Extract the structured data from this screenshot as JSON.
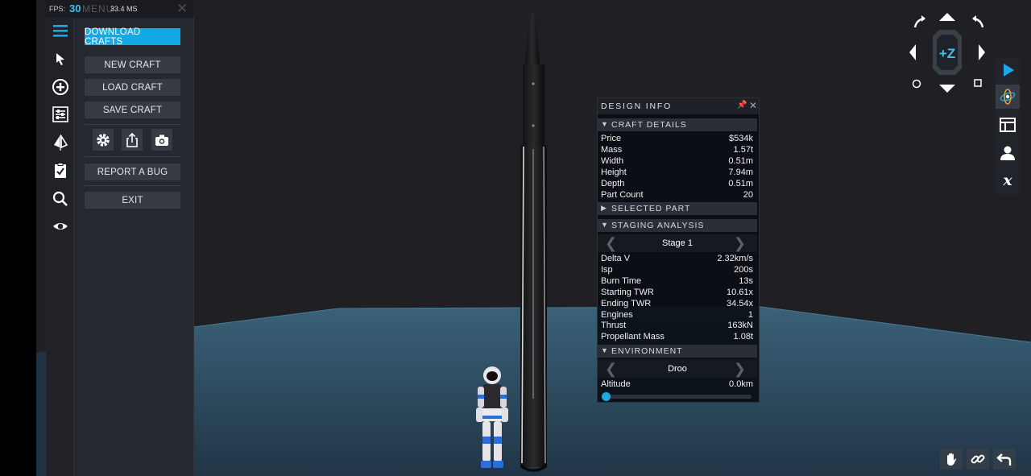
{
  "fps_bar": {
    "fps_label": "FPS:",
    "fps_value": "30",
    "ghost_text": "MENU",
    "ms_value": "33.4",
    "ms_unit": "MS",
    "close_glyph": "✕"
  },
  "icon_bar": [
    "hamburger-menu-icon",
    "select-cursor-icon",
    "add-part-icon",
    "properties-icon",
    "symmetry-icon",
    "checklist-icon",
    "search-icon",
    "view-icon"
  ],
  "menu": {
    "download_crafts": "DOWNLOAD CRAFTS",
    "new_craft": "NEW CRAFT",
    "load_craft": "LOAD CRAFT",
    "save_craft": "SAVE CRAFT",
    "tool_icons": [
      "gear-icon",
      "share-icon",
      "camera-icon"
    ],
    "report_bug": "REPORT A BUG",
    "exit": "EXIT"
  },
  "design_info": {
    "title": "DESIGN INFO",
    "pin_glyph": "📌",
    "close_glyph": "✕",
    "craft_details": {
      "header": "CRAFT DETAILS",
      "rows": [
        {
          "k": "Price",
          "v": "$534k"
        },
        {
          "k": "Mass",
          "v": "1.57t"
        },
        {
          "k": "Width",
          "v": "0.51m"
        },
        {
          "k": "Height",
          "v": "7.94m"
        },
        {
          "k": "Depth",
          "v": "0.51m"
        },
        {
          "k": "Part Count",
          "v": "20"
        }
      ]
    },
    "selected_part": {
      "header": "SELECTED PART"
    },
    "staging_analysis": {
      "header": "STAGING ANALYSIS",
      "stage": "Stage 1",
      "rows": [
        {
          "k": "Delta V",
          "v": "2.32km/s"
        },
        {
          "k": "Isp",
          "v": "200s"
        },
        {
          "k": "Burn Time",
          "v": "13s"
        },
        {
          "k": "Starting TWR",
          "v": "10.61x"
        },
        {
          "k": "Ending TWR",
          "v": "34.54x"
        },
        {
          "k": "Engines",
          "v": "1"
        },
        {
          "k": "Thrust",
          "v": "163kN"
        },
        {
          "k": "Propellant Mass",
          "v": "1.08t"
        }
      ]
    },
    "environment": {
      "header": "ENVIRONMENT",
      "planet": "Droo",
      "altitude_label": "Altitude",
      "altitude_value": "0.0km",
      "altitude_slider_fraction": 0.0
    }
  },
  "camera_nav": {
    "center_label": "+Z"
  },
  "right_bar": [
    "play-icon",
    "orbit-view-icon",
    "layout-icon",
    "crew-icon",
    "variables-icon"
  ],
  "bottom_right": [
    "hand-pan-icon",
    "link-icon",
    "undo-icon"
  ],
  "colors": {
    "accent": "#12a9e6",
    "panel": "#25282f",
    "ground": "#2f4e66"
  }
}
